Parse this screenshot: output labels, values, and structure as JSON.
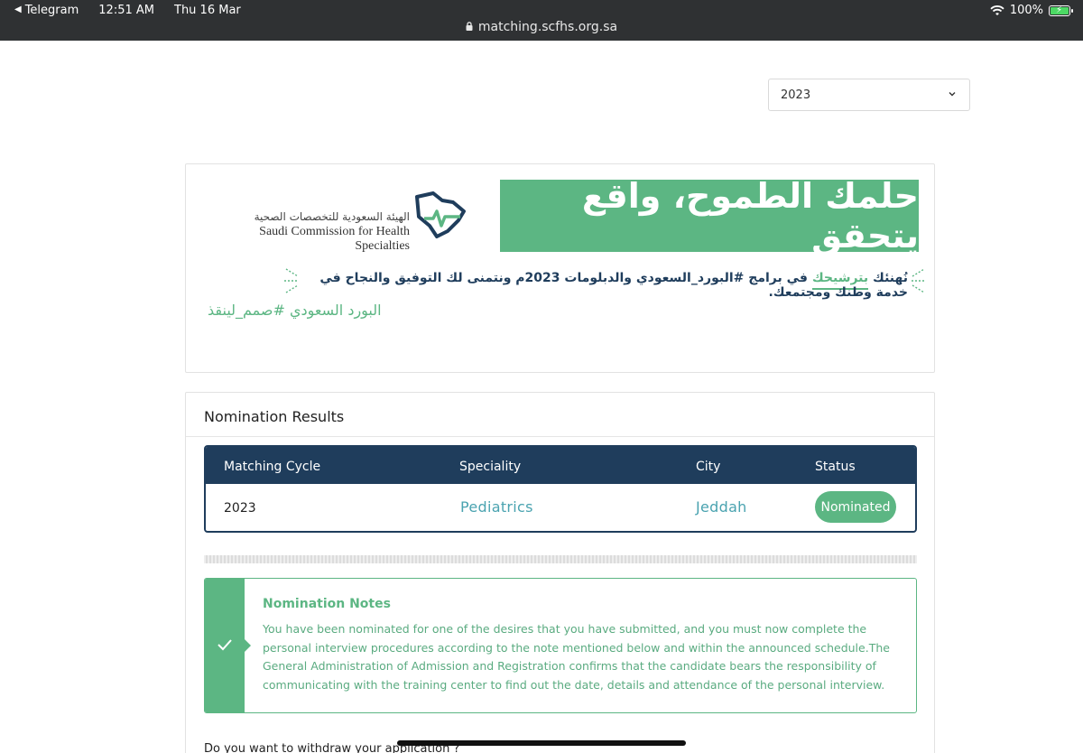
{
  "status_bar": {
    "back_app": "Telegram",
    "time": "12:51 AM",
    "date": "Thu 16 Mar",
    "battery": "100%",
    "url": "matching.scfhs.org.sa"
  },
  "year_select": {
    "value": "2023"
  },
  "banner": {
    "slogan": "حلمك الطموح، واقع يتحقق",
    "logo_arabic": "الهيئة السعودية للتخصصات الصحية",
    "logo_english": "Saudi Commission for Health Specialties",
    "congrats_prefix": "نُهنئك ",
    "congrats_highlight": "بترشيحك",
    "congrats_suffix": " في برامج #البورد_السعودي والدبلومات 2023م ونتمنى لك التوفيق والنجاح في خدمة وطنك ومجتمعك.",
    "hashtag": "البورد السعودي #صمم_لينقذ"
  },
  "results": {
    "title": "Nomination Results",
    "columns": [
      "Matching Cycle",
      "Speciality",
      "City",
      "Status"
    ],
    "row": {
      "cycle": "2023",
      "speciality": "Pediatrics",
      "city": "Jeddah",
      "status": "Nominated"
    },
    "notes": {
      "title": "Nomination Notes",
      "body": "You have been nominated for one of the desires that you have submitted, and you must now complete the personal interview procedures according to the note mentioned below and within the announced schedule.The General Administration of Admission and Registration confirms that the candidate bears the responsibility of communicating with the training center to find out the date, details and attendance of the personal interview."
    },
    "withdraw_question": "Do you want to withdraw your application ?"
  },
  "colors": {
    "brand_green": "#5cb683",
    "navy": "#1f3d5c",
    "teal_text": "#4aa3b0"
  }
}
